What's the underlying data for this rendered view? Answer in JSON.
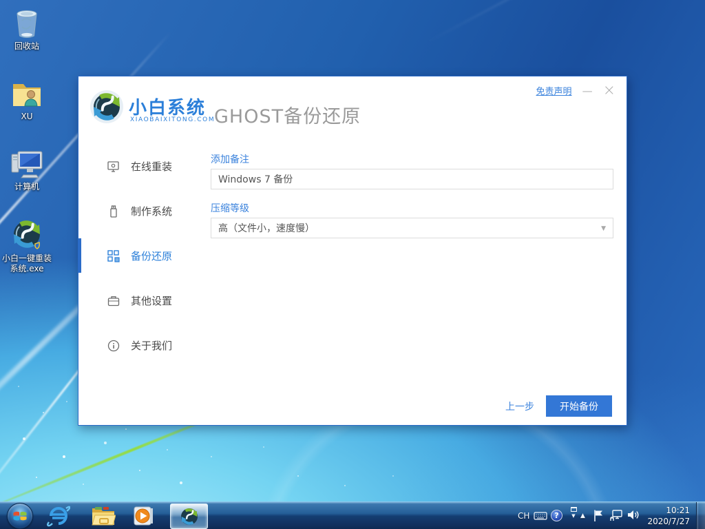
{
  "colors": {
    "brand_blue": "#2b7fd9",
    "link_blue": "#3a82dc",
    "button_blue": "#3377d6",
    "title_gray": "#9a9a9a",
    "field_border": "#dcdcdc",
    "window_border": "#2a6ac8",
    "selected_indicator": "#2b6cc8"
  },
  "desktop": {
    "icons": [
      {
        "name": "recycle-bin",
        "label": "回收站"
      },
      {
        "name": "xu-folder",
        "label": "XU"
      },
      {
        "name": "computer",
        "label": "计算机"
      },
      {
        "name": "xiaobai-installer",
        "label": "小白一键重装",
        "label2": "系统.exe"
      }
    ]
  },
  "app_window": {
    "disclaimer": "免责声明",
    "minimize_glyph": "—",
    "close_glyph": "×",
    "brand_name": "小白系统",
    "brand_domain": "XIAOBAIXITONG.COM",
    "page_title": "GHOST备份还原",
    "sidebar": [
      {
        "name": "online-reinstall",
        "label": "在线重装",
        "selected": false
      },
      {
        "name": "make-system",
        "label": "制作系统",
        "selected": false
      },
      {
        "name": "backup-restore",
        "label": "备份还原",
        "selected": true
      },
      {
        "name": "other-settings",
        "label": "其他设置",
        "selected": false
      },
      {
        "name": "about-us",
        "label": "关于我们",
        "selected": false
      }
    ],
    "form": {
      "note_label": "添加备注",
      "note_value": "Windows 7 备份",
      "compress_label": "压缩等级",
      "compress_value": "高（文件小，速度慢）",
      "caret_glyph": "▼"
    },
    "footer": {
      "back_label": "上一步",
      "start_label": "开始备份"
    }
  },
  "taskbar": {
    "tray": {
      "lang_indicator": "CH",
      "help_glyph": "?",
      "show_hidden_glyph": "▲",
      "time": "10:21",
      "date": "2020/7/27"
    }
  }
}
